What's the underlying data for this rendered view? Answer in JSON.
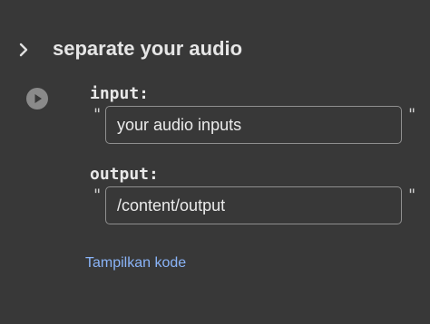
{
  "section": {
    "title": "separate your audio",
    "expand_icon": "chevron-right-icon"
  },
  "run": {
    "icon": "play-circle-icon"
  },
  "fields": {
    "input": {
      "label": "input:",
      "value": "your audio inputs",
      "quote_open": "\"",
      "quote_close": "\""
    },
    "output": {
      "label": "output:",
      "value": "/content/output",
      "quote_open": "\"",
      "quote_close": "\""
    }
  },
  "show_code": {
    "label": "Tampilkan kode"
  },
  "colors": {
    "background": "#383838",
    "link": "#8ab4f8",
    "border": "#8f8f8f"
  }
}
